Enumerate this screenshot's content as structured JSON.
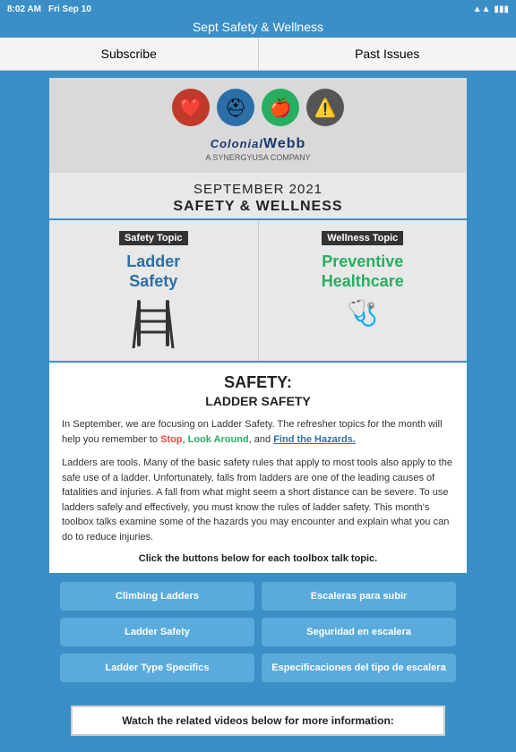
{
  "statusBar": {
    "time": "8:02 AM",
    "day": "Fri Sep 10",
    "wifi": "wifi",
    "battery": "battery"
  },
  "titleBar": {
    "title": "Sept Safety & Wellness"
  },
  "nav": {
    "subscribe": "Subscribe",
    "pastIssues": "Past Issues"
  },
  "header": {
    "icons": [
      "❤️",
      "⛑",
      "🍎",
      "⚠️"
    ],
    "companyName": "ColonialWebb",
    "companySubtitle": "A SYNERGYUSA COMPANY"
  },
  "monthTitle": {
    "month": "SEPTEMBER 2021",
    "subtitle": "SAFETY & WELLNESS"
  },
  "topics": {
    "safetyLabel": "Safety Topic",
    "safetyTitle": "Ladder\nSafety",
    "wellnessLabel": "Wellness Topic",
    "wellnessTitle": "Preventive\nHealthcare"
  },
  "safetySection": {
    "heading": "SAFETY:",
    "subheading": "LADDER SAFETY",
    "paragraph1": "In September, we are focusing on Ladder Safety. The refresher topics for the month will help you remember to Stop, Look Around, and Find the Hazards.",
    "paragraph2": "Ladders are tools. Many of the basic safety rules that apply to most tools also apply to the safe use of a ladder. Unfortunately, falls from ladders are one of the leading causes of fatalities and injuries. A fall from what might seem a short distance can be severe. To use ladders safely and effectively, you must know the rules of ladder safety. This month's toolbox talks examine some of the hazards you may encounter and explain what you can do to reduce injuries.",
    "clickInstruction": "Click the buttons below for each toolbox talk topic."
  },
  "buttons": [
    {
      "english": "Climbing Ladders",
      "spanish": "Escaleras para subir"
    },
    {
      "english": "Ladder Safety",
      "spanish": "Seguridad en escalera"
    },
    {
      "english": "Ladder Type Specifics",
      "spanish": "Especificaciones del tipo de escalera"
    }
  ],
  "watchSection": {
    "text": "Watch the related videos below for more information:"
  }
}
